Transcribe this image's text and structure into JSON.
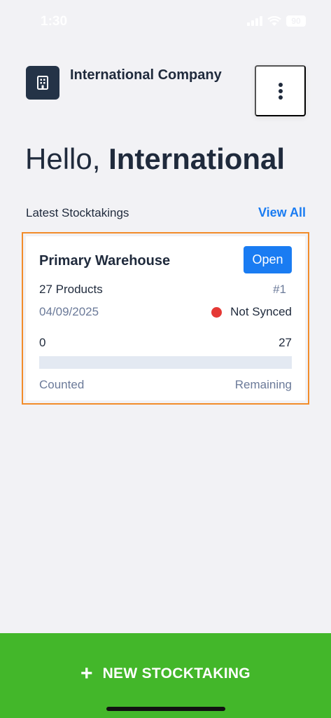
{
  "status_bar": {
    "time": "1:30",
    "battery": "90"
  },
  "header": {
    "company_name": "International Company",
    "logo_icon": "building-icon",
    "menu_icon": "more-vertical-icon"
  },
  "greeting": {
    "prefix": "Hello,",
    "name": "International"
  },
  "latest": {
    "title": "Latest Stocktakings",
    "view_all": "View All"
  },
  "card": {
    "warehouse": "Primary Warehouse",
    "status": "Open",
    "products": "27 Products",
    "number": "#1",
    "date": "04/09/2025",
    "sync_status": "Not Synced",
    "counted": "0",
    "total": "27",
    "progress_fraction": 0,
    "counted_label": "Counted",
    "remaining_label": "Remaining"
  },
  "footer": {
    "new_button": "NEW STOCKTAKING"
  },
  "colors": {
    "accent": "#1a7cf2",
    "primary_action": "#43b72a",
    "highlight_border": "#f28c2a",
    "not_synced": "#e53935",
    "logo_bg": "#243347"
  }
}
